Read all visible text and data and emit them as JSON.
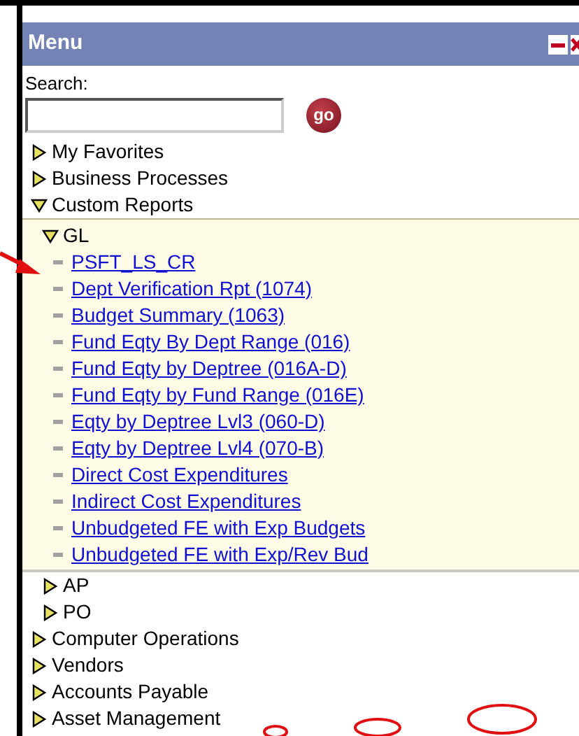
{
  "panel": {
    "title": "Menu",
    "search": {
      "label": "Search:",
      "button": "go"
    },
    "tree": [
      {
        "kind": "folder",
        "label": "My Favorites",
        "expanded": false
      },
      {
        "kind": "folder",
        "label": "Business Processes",
        "expanded": false
      },
      {
        "kind": "folder",
        "label": "Custom Reports",
        "expanded": true,
        "children": [
          {
            "kind": "folder",
            "label": "GL",
            "expanded": true,
            "children": [
              {
                "kind": "link",
                "label": "PSFT_LS_CR"
              },
              {
                "kind": "link",
                "label": "Dept Verification Rpt (1074)"
              },
              {
                "kind": "link",
                "label": "Budget Summary (1063)"
              },
              {
                "kind": "link",
                "label": "Fund Eqty By Dept Range (016)"
              },
              {
                "kind": "link",
                "label": "Fund Eqty by Deptree (016A-D)"
              },
              {
                "kind": "link",
                "label": "Fund Eqty by Fund Range (016E)"
              },
              {
                "kind": "link",
                "label": "Eqty by Deptree Lvl3 (060-D)"
              },
              {
                "kind": "link",
                "label": "Eqty by Deptree Lvl4 (070-B)"
              },
              {
                "kind": "link",
                "label": "Direct Cost Expenditures"
              },
              {
                "kind": "link",
                "label": "Indirect Cost Expenditures"
              },
              {
                "kind": "link",
                "label": "Unbudgeted FE with Exp Budgets"
              },
              {
                "kind": "link",
                "label": "Unbudgeted FE with Exp/Rev Bud"
              }
            ]
          },
          {
            "kind": "folder",
            "label": "AP",
            "expanded": false
          },
          {
            "kind": "folder",
            "label": "PO",
            "expanded": false
          }
        ]
      },
      {
        "kind": "folder",
        "label": "Computer Operations",
        "expanded": false
      },
      {
        "kind": "folder",
        "label": "Vendors",
        "expanded": false
      },
      {
        "kind": "folder",
        "label": "Accounts Payable",
        "expanded": false
      },
      {
        "kind": "folder",
        "label": "Asset Management",
        "expanded": false
      }
    ]
  }
}
